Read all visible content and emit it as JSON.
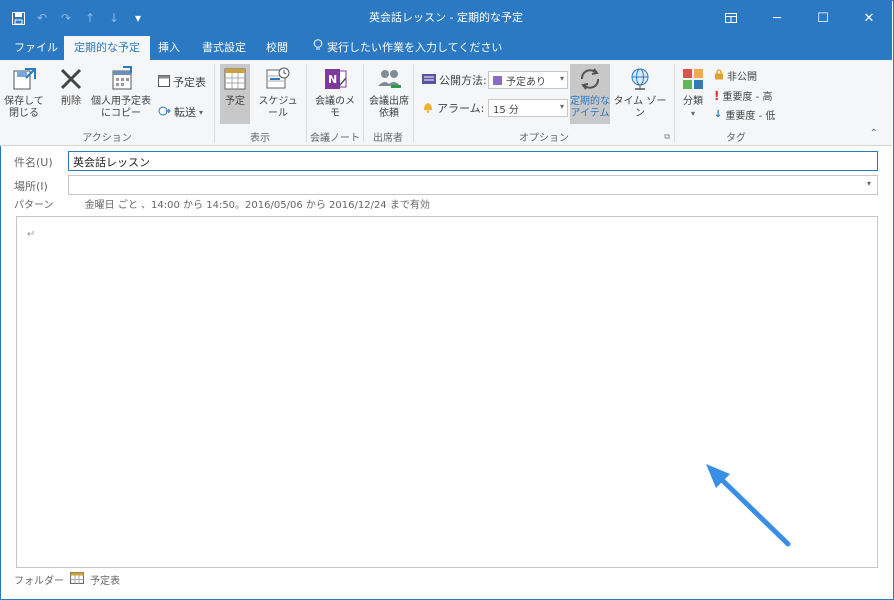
{
  "window": {
    "title": "英会話レッスン - 定期的な予定",
    "accent": "#2b79c2"
  },
  "qat": {
    "save_icon": "save-icon",
    "undo_icon": "undo-icon",
    "redo_icon": "redo-icon",
    "up_icon": "arrow-up-icon",
    "down_icon": "arrow-down-icon",
    "customize_icon": "customize-icon"
  },
  "tabs": [
    {
      "label": "ファイル"
    },
    {
      "label": "定期的な予定"
    },
    {
      "label": "挿入"
    },
    {
      "label": "書式設定"
    },
    {
      "label": "校閲"
    }
  ],
  "tell_me": "実行したい作業を入力してください",
  "ribbon": {
    "actions": {
      "save_close": "保存して\n閉じる",
      "delete": "削除",
      "copy_personal": "個人用予定表\nにコピー",
      "calendar": "予定表",
      "forward": "転送",
      "group_label": "アクション"
    },
    "show": {
      "appointment": "予定",
      "schedule": "スケジュール",
      "group_label": "表示"
    },
    "notes": {
      "meeting_notes": "会議のメモ",
      "group_label": "会議ノート"
    },
    "attendees": {
      "request": "会議出席\n依頼",
      "group_label": "出席者"
    },
    "options": {
      "show_as_label": "公開方法:",
      "show_as_value": "予定あり",
      "reminder_label": "アラーム:",
      "reminder_value": "15 分",
      "recurrence": "定期的な\nアイテム",
      "time_zone": "タイム ゾーン",
      "group_label": "オプション"
    },
    "tags": {
      "categorize": "分類",
      "private": "非公開",
      "high": "重要度 - 高",
      "low": "重要度 - 低",
      "group_label": "タグ"
    }
  },
  "form": {
    "subject_label": "件名(U)",
    "subject_value": "英会話レッスン",
    "location_label": "場所(I)",
    "location_value": "",
    "pattern_label": "パターン",
    "pattern_value": "金曜日 ごと 、14:00 から 14:50。2016/05/06 から 2016/12/24 まで有効"
  },
  "body": {
    "paragraph_mark": "↵"
  },
  "footer": {
    "folder_label": "フォルダー",
    "folder_value": "予定表"
  }
}
